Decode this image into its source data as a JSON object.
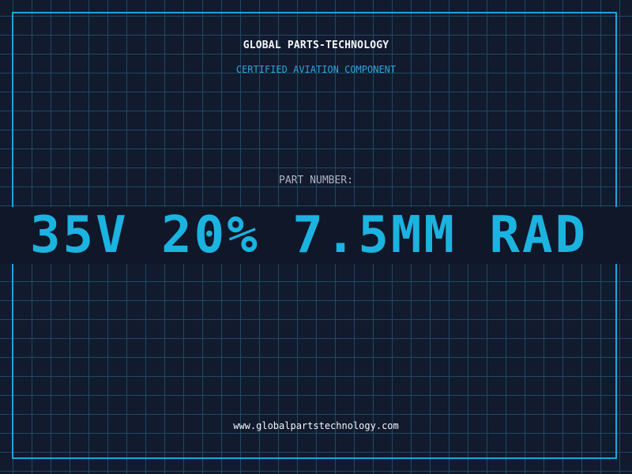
{
  "header": {
    "brand": "GLOBAL PARTS-TECHNOLOGY",
    "subtitle": "CERTIFIED AVIATION COMPONENT"
  },
  "part": {
    "label": "PART NUMBER:",
    "number": "35V 20% 7.5MM RAD"
  },
  "footer": {
    "website": "www.globalpartstechnology.com"
  },
  "colors": {
    "background": "#121a2e",
    "grid": "#1e4a62",
    "accent": "#1bb3e0",
    "text": "#f2f6fa",
    "muted": "#a9b5c4"
  }
}
